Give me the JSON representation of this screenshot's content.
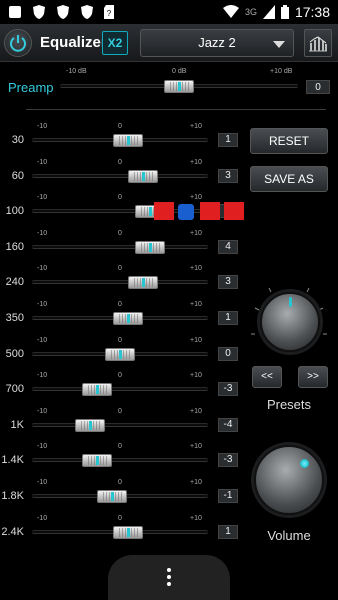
{
  "status_bar": {
    "network": "3G",
    "time": "17:38"
  },
  "app": {
    "title": "Equalizer",
    "x2_label": "X2",
    "preset_name": "Jazz 2"
  },
  "preamp": {
    "label": "Preamp",
    "scale_min": "-10 dB",
    "scale_mid": "0 dB",
    "scale_max": "+10 dB",
    "value": "0",
    "fraction": 0.5
  },
  "band_scale": {
    "min": "-10",
    "mid": "0",
    "max": "+10"
  },
  "bands": [
    {
      "label": "30",
      "value": "1",
      "gain": 1
    },
    {
      "label": "60",
      "value": "3",
      "gain": 3
    },
    {
      "label": "100",
      "value": "4",
      "gain": 4
    },
    {
      "label": "160",
      "value": "4",
      "gain": 4
    },
    {
      "label": "240",
      "value": "3",
      "gain": 3
    },
    {
      "label": "350",
      "value": "1",
      "gain": 1
    },
    {
      "label": "500",
      "value": "0",
      "gain": 0
    },
    {
      "label": "700",
      "value": "-3",
      "gain": -3
    },
    {
      "label": "1K",
      "value": "-4",
      "gain": -4
    },
    {
      "label": "1.4K",
      "value": "-3",
      "gain": -3
    },
    {
      "label": "1.8K",
      "value": "-1",
      "gain": -1
    },
    {
      "label": "2.4K",
      "value": "1",
      "gain": 1
    }
  ],
  "controls": {
    "reset_label": "RESET",
    "save_as_label": "SAVE AS",
    "prev_label": "<<",
    "next_label": ">>",
    "presets_label": "Presets",
    "volume_label": "Volume"
  },
  "colors": {
    "accent": "#27c5d0",
    "background": "#000000"
  },
  "icons": {
    "power": "power-icon",
    "graph": "graph-icon",
    "menu": "overflow-menu-icon"
  }
}
